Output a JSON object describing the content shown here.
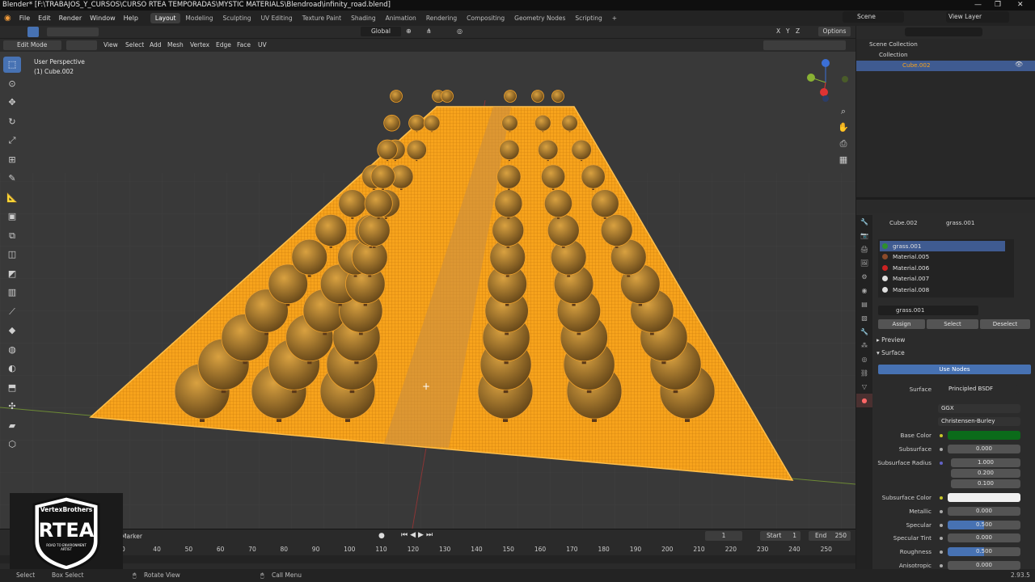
{
  "titlebar": {
    "title": "Blender* [F:\\TRABAJOS_Y_CURSOS\\CURSO RTEA TEMPORADAS\\MYSTIC MATERIALS\\Blendroad\\infinity_road.blend]"
  },
  "menu": [
    "File",
    "Edit",
    "Render",
    "Window",
    "Help"
  ],
  "workspaces": [
    "Layout",
    "Modeling",
    "Sculpting",
    "UV Editing",
    "Texture Paint",
    "Shading",
    "Animation",
    "Rendering",
    "Compositing",
    "Geometry Nodes",
    "Scripting"
  ],
  "active_workspace": "Layout",
  "scene": {
    "name": "Scene",
    "view_layer": "View Layer"
  },
  "header": {
    "transform": "Global",
    "options": "Options",
    "x": "X",
    "y": "Y",
    "z": "Z"
  },
  "edit_header": {
    "mode": "Edit Mode",
    "menus": [
      "View",
      "Select",
      "Add",
      "Mesh",
      "Vertex",
      "Edge",
      "Face",
      "UV"
    ]
  },
  "viewport": {
    "perspective": "User Perspective",
    "object": "(1) Cube.002"
  },
  "outliner": {
    "scene_collection": "Scene Collection",
    "collection": "Collection",
    "object": "Cube.002"
  },
  "properties": {
    "object": "Cube.002",
    "material": "grass.001",
    "slots": [
      {
        "name": "grass.001",
        "color": "#2e8f2e"
      },
      {
        "name": "Material.005",
        "color": "#8b4a2a"
      },
      {
        "name": "Material.006",
        "color": "#cc2222"
      },
      {
        "name": "Material.007",
        "color": "#e0e0e0"
      },
      {
        "name": "Material.008",
        "color": "#e0e0e0"
      }
    ],
    "material_field": "grass.001",
    "assign": "Assign",
    "select": "Select",
    "deselect": "Deselect",
    "preview": "Preview",
    "surface_panel": "Surface",
    "use_nodes": "Use Nodes",
    "surface_label": "Surface",
    "surface_value": "Principled BSDF",
    "distribution": "GGX",
    "subsurface_method": "Christensen-Burley",
    "base_color_label": "Base Color",
    "base_color": "#0b6b1a",
    "subsurface_label": "Subsurface",
    "subsurface": "0.000",
    "subsurface_radius_label": "Subsurface Radius",
    "radius": [
      "1.000",
      "0.200",
      "0.100"
    ],
    "subsurface_color_label": "Subsurface Color",
    "subsurface_color": "#f0f0f0",
    "metallic_label": "Metallic",
    "metallic": "0.000",
    "specular_label": "Specular",
    "specular": "0.500",
    "specular_tint_label": "Specular Tint",
    "specular_tint": "0.000",
    "roughness_label": "Roughness",
    "roughness": "0.500",
    "anisotropic_label": "Anisotropic",
    "anisotropic": "0.000"
  },
  "timeline": {
    "marker": "Marker",
    "frame": "1",
    "start_label": "Start",
    "start": "1",
    "end_label": "End",
    "end": "250",
    "ticks": [
      "0",
      "40",
      "50",
      "60",
      "70",
      "80",
      "90",
      "100",
      "110",
      "120",
      "130",
      "140",
      "150",
      "160",
      "170",
      "180",
      "190",
      "200",
      "210",
      "220",
      "230",
      "240",
      "250"
    ]
  },
  "statusbar": {
    "select": "Select",
    "box_select": "Box Select",
    "rotate": "Rotate View",
    "call_menu": "Call Menu",
    "version": "2.93.5"
  },
  "logo": {
    "top": "VertexBrothers",
    "main": "RTEA",
    "sub": "ROAD TO ENVIRONMENT ARTIST"
  },
  "colors": {
    "accent": "#4772b3",
    "selection": "#ffa020",
    "header": "#2a2a2a",
    "viewport": "#393939"
  }
}
